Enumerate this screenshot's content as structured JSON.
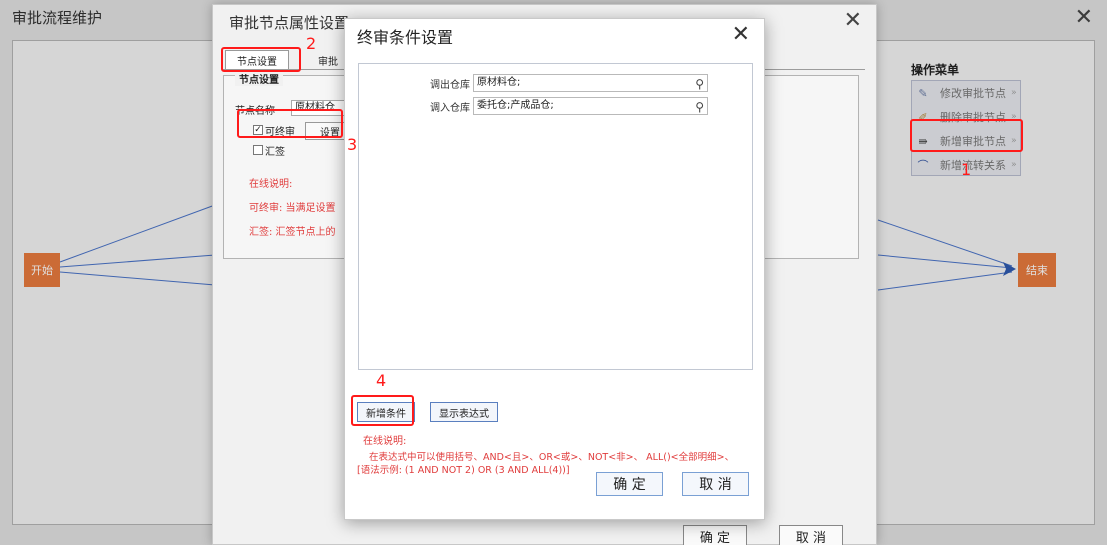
{
  "base_window": {
    "title": "审批流程维护",
    "close_glyph": "✕",
    "start_node": "开始",
    "end_node": "结束"
  },
  "op_menu": {
    "title": "操作菜单",
    "items": [
      {
        "label": "修改审批节点",
        "icon": "edit-icon"
      },
      {
        "label": "删除审批节点",
        "icon": "delete-icon"
      },
      {
        "label": "新增审批节点",
        "icon": "add-node-icon"
      },
      {
        "label": "新增流转关系",
        "icon": "add-relation-icon"
      }
    ],
    "item_suffix": "»"
  },
  "node_window": {
    "title": "审批节点属性设置",
    "close_glyph": "✕",
    "tabs": [
      "节点设置",
      "审批"
    ],
    "section_legend": "节点设置",
    "name_label": "节点名称",
    "name_value": "原材料仓",
    "final_label": "可终审",
    "final_checked": true,
    "set_button": "设置",
    "countersign_label": "汇签",
    "countersign_checked": false,
    "online_note": "在线说明:",
    "final_note": "可终审:  当满足设置",
    "countersign_note": "汇签:  汇签节点上的",
    "confirm": "确 定",
    "cancel": "取 消"
  },
  "final_dialog": {
    "title": "终审条件设置",
    "close_glyph": "✕",
    "conditions": [
      {
        "label": "调出仓库",
        "value": "原材料仓;"
      },
      {
        "label": "调入仓库",
        "value": "委托仓;产成品仓;"
      }
    ],
    "add_condition": "新增条件",
    "show_expression": "显示表达式",
    "note_title": "在线说明:",
    "note_line1": "在表达式中可以使用括号、AND<且>、OR<或>、NOT<非>、 ALL()<全部明细>、",
    "note_line2": "[语法示例: (1 AND NOT 2) OR (3 AND ALL(4))]",
    "confirm": "确 定",
    "cancel": "取 消"
  },
  "annotations": [
    "1",
    "2",
    "3",
    "4"
  ],
  "colors": {
    "annotation_red": "#ff1a1a",
    "node_orange": "#e77a3e",
    "flow_line": "#4a74c9",
    "note_red": "#e03c3c"
  }
}
